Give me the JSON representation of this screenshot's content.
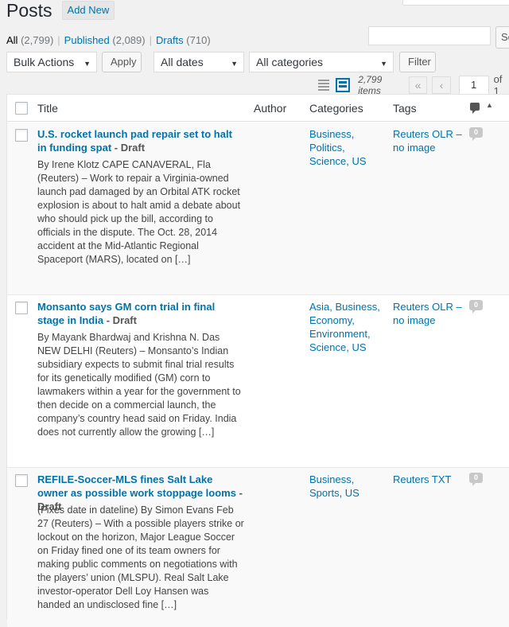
{
  "header": {
    "title": "Posts",
    "add_new": "Add New"
  },
  "views": [
    {
      "label": "All",
      "count": "(2,799)"
    },
    {
      "label": "Published",
      "count": "(2,089)"
    },
    {
      "label": "Drafts",
      "count": "(710)"
    }
  ],
  "separator": "|",
  "search": {
    "button_label": "Se"
  },
  "filters": {
    "bulk_actions": "Bulk Actions",
    "apply": "Apply",
    "dates": "All dates",
    "categories": "All categories",
    "filter": "Filter"
  },
  "pagination": {
    "items": "2,799 items",
    "first": "«",
    "prev": "‹",
    "current_page": "1",
    "of": "of 1"
  },
  "table": {
    "columns": {
      "title": "Title",
      "author": "Author",
      "categories": "Categories",
      "tags": "Tags"
    },
    "rows": [
      {
        "title": "U.S. rocket launch pad repair set to halt in funding spat",
        "state": " - Draft",
        "excerpt": "By Irene Klotz CAPE CANAVERAL, Fla (Reuters) – Work to repair a Virginia-owned launch pad damaged by an Orbital ATK rocket explosion is about to halt amid a debate about who should pick up the bill, according to officials in the dispute. The Oct. 28, 2014 accident at the Mid-Atlantic Regional Spaceport (MARS), located on […]",
        "categories": "Business, Politics, Science, US",
        "tags": "Reuters OLR – no image",
        "comments": "0"
      },
      {
        "title": "Monsanto says GM corn trial in final stage in India",
        "state": " - Draft",
        "excerpt": "By Mayank Bhardwaj and Krishna N. Das NEW DELHI (Reuters) – Monsanto’s Indian subsidiary expects to submit final trial results for its genetically modified (GM) corn to lawmakers within a year for the government to then decide on a commercial launch, the company’s country head said on Friday. India does not currently allow the growing […]",
        "categories": "Asia, Business, Economy, Environment, Science, US",
        "tags": "Reuters OLR – no image",
        "comments": "0"
      },
      {
        "title": "REFILE-Soccer-MLS fines Salt Lake owner as possible work stoppage looms",
        "state": " - Draft",
        "excerpt": "(Fixes date in dateline) By Simon Evans Feb 27 (Reuters) – With a possible players strike or lockout on the horizon, Major League Soccer on Friday fined one of its team owners for making public comments on negotiations with the players’ union (MLSPU). Real Salt Lake investor-operator Dell Loy Hansen was handed an undisclosed fine […]",
        "categories": "Business, Sports, US",
        "tags": "Reuters TXT",
        "comments": "0"
      }
    ]
  }
}
